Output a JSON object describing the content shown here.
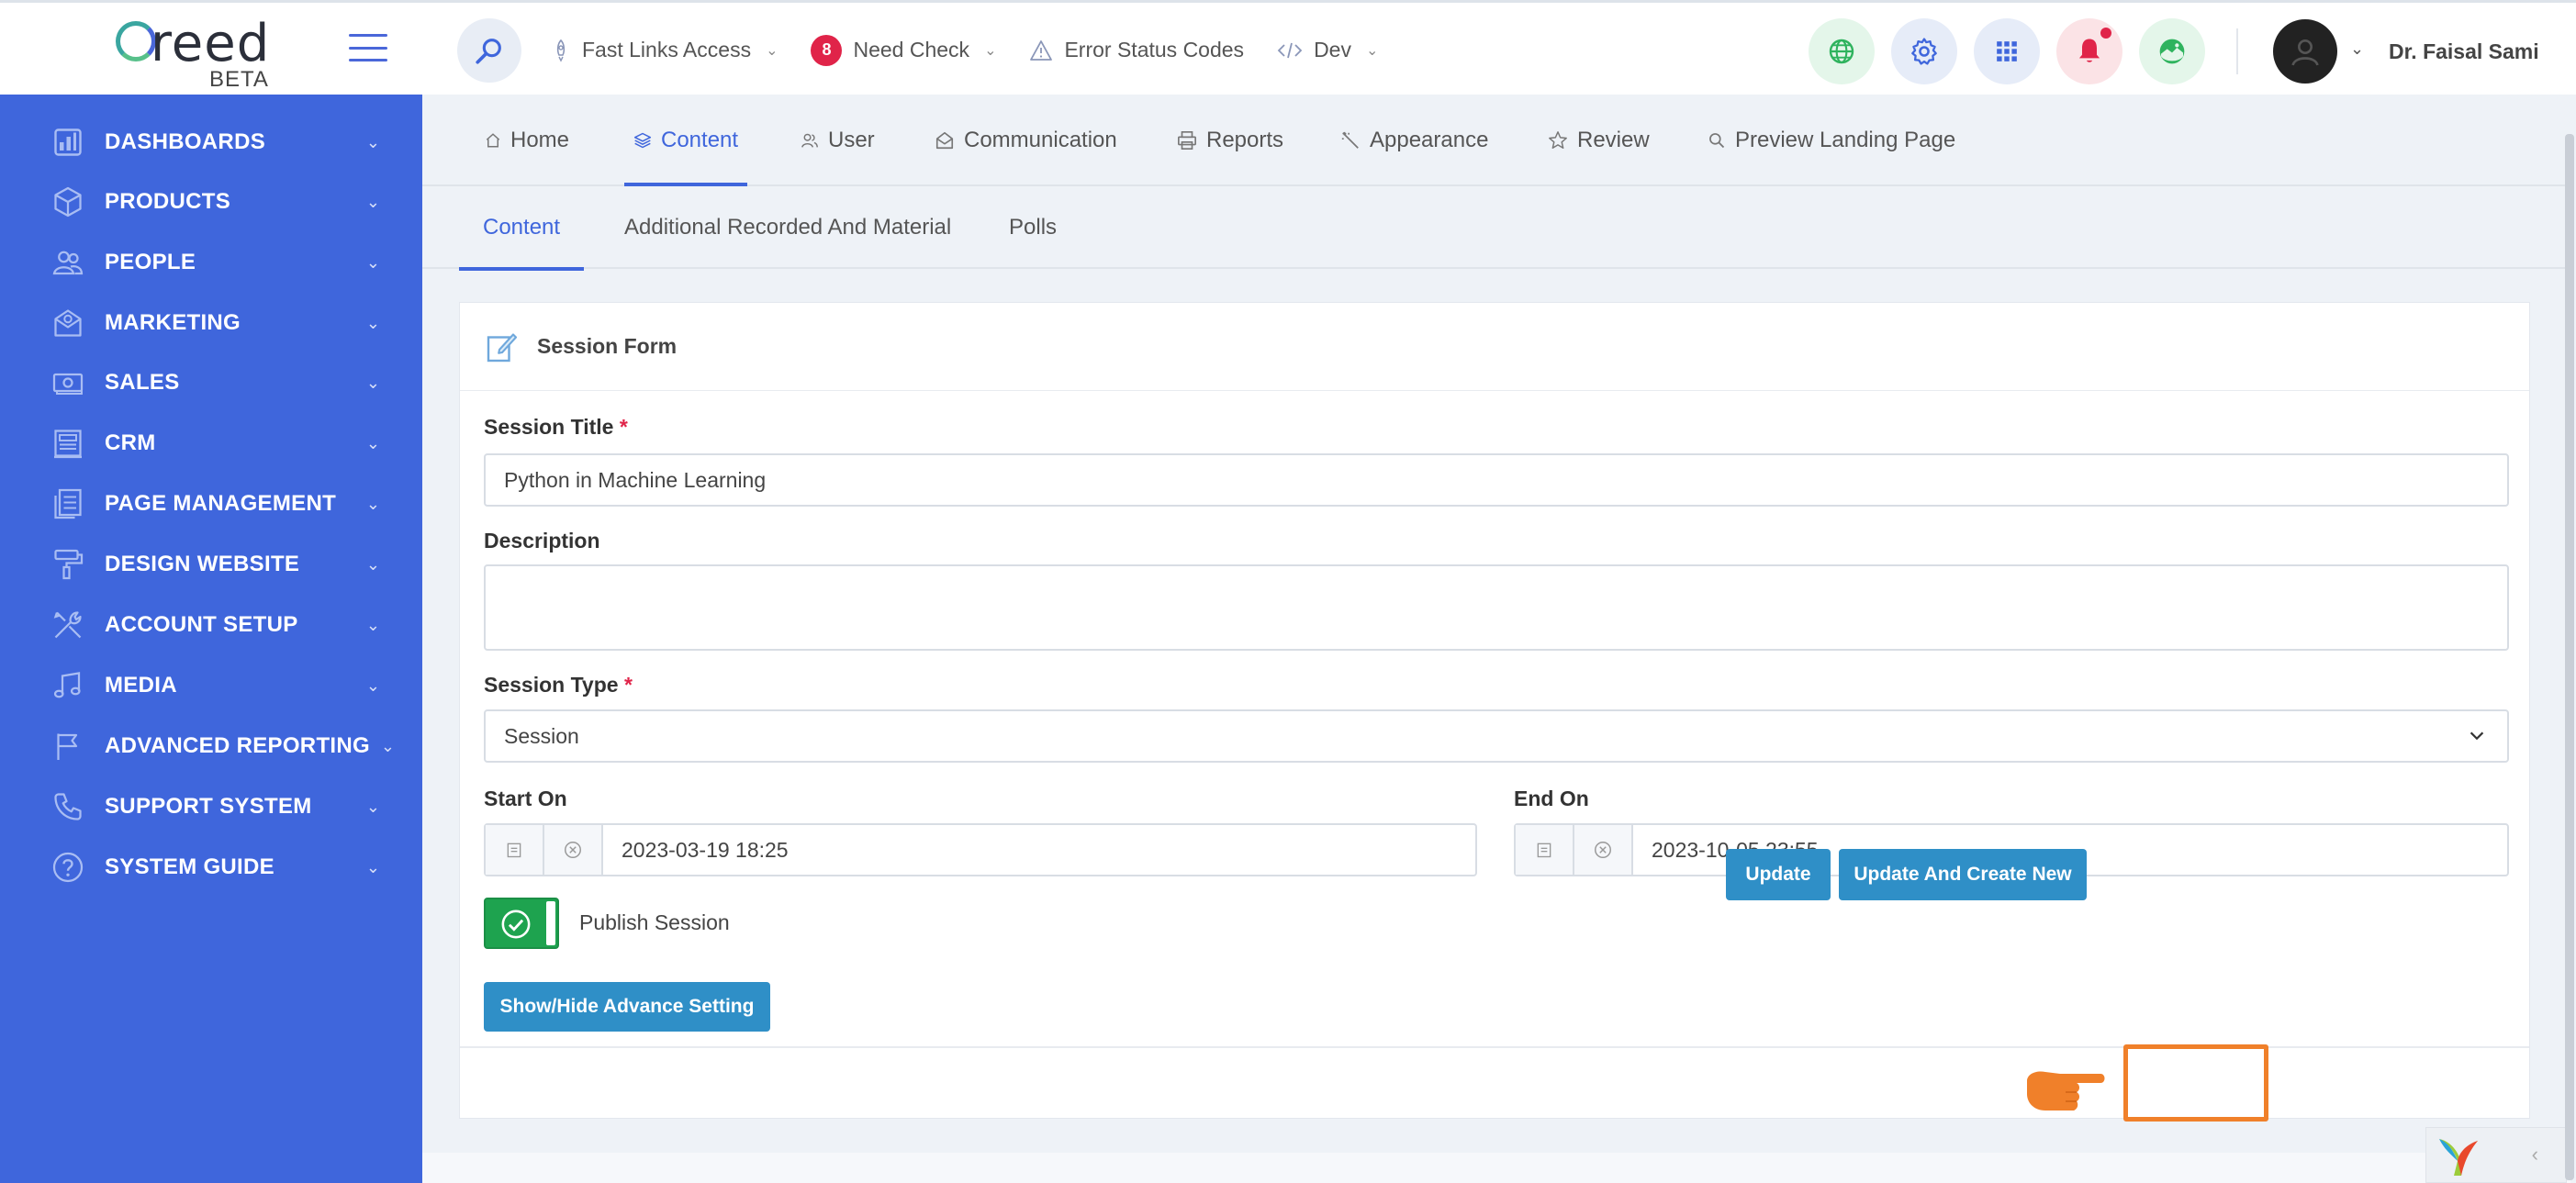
{
  "brand": {
    "name": "reed",
    "tag": "BETA"
  },
  "topnav": {
    "fast_links": "Fast Links Access",
    "need_check_count": "8",
    "need_check": "Need Check",
    "error_codes": "Error Status Codes",
    "dev": "Dev"
  },
  "user": {
    "name": "Dr. Faisal Sami"
  },
  "sidebar": {
    "items": [
      {
        "label": "DASHBOARDS",
        "icon": "dashboard-icon"
      },
      {
        "label": "PRODUCTS",
        "icon": "box-icon"
      },
      {
        "label": "PEOPLE",
        "icon": "people-icon"
      },
      {
        "label": "MARKETING",
        "icon": "mail-icon"
      },
      {
        "label": "SALES",
        "icon": "cash-icon"
      },
      {
        "label": "CRM",
        "icon": "newspaper-icon"
      },
      {
        "label": "PAGE MANAGEMENT",
        "icon": "pages-icon"
      },
      {
        "label": "DESIGN WEBSITE",
        "icon": "paint-roller-icon"
      },
      {
        "label": "ACCOUNT SETUP",
        "icon": "tools-icon"
      },
      {
        "label": "MEDIA",
        "icon": "music-icon"
      },
      {
        "label": "ADVANCED REPORTING",
        "icon": "flag-icon"
      },
      {
        "label": "SUPPORT SYSTEM",
        "icon": "phone-icon"
      },
      {
        "label": "SYSTEM GUIDE",
        "icon": "help-icon"
      }
    ]
  },
  "tabs": {
    "home": "Home",
    "content": "Content",
    "user": "User",
    "communication": "Communication",
    "reports": "Reports",
    "appearance": "Appearance",
    "review": "Review",
    "preview": "Preview Landing Page"
  },
  "subtabs": {
    "content": "Content",
    "additional": "Additional Recorded And Material",
    "polls": "Polls"
  },
  "form": {
    "title": "Session Form",
    "session_title_label": "Session Title",
    "session_title_value": "Python in Machine Learning",
    "description_label": "Description",
    "description_value": "",
    "session_type_label": "Session Type",
    "session_type_value": "Session",
    "start_label": "Start On",
    "start_value": "2023-03-19 18:25",
    "end_label": "End On",
    "end_value": "2023-10-05 23:55",
    "publish_label": "Publish Session",
    "publish_on": true,
    "advance_btn": "Show/Hide Advance Setting",
    "update_btn": "Update",
    "update_create_btn": "Update And Create New",
    "required_mark": "*"
  },
  "colors": {
    "sidebar": "#3f66dc",
    "primary_btn": "#2f8fc7",
    "toggle_on": "#1ea34f",
    "highlight": "#f0802a",
    "badge": "#e02449"
  }
}
